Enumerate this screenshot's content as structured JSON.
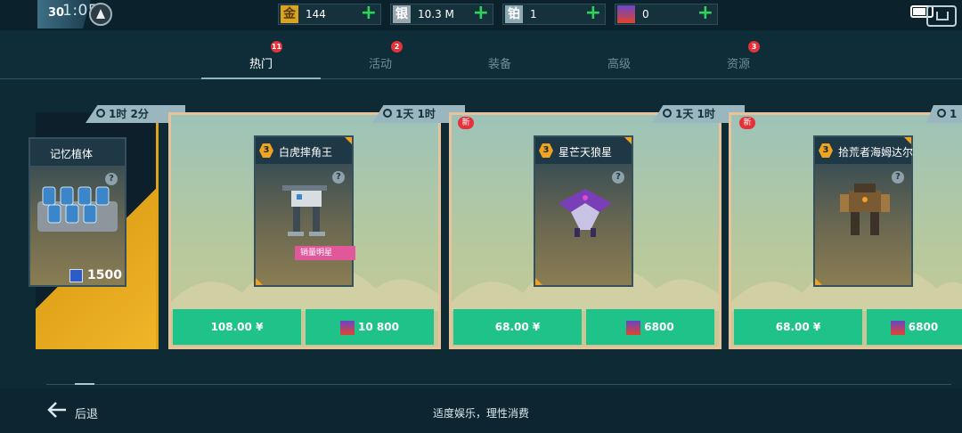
{
  "status": {
    "level": "30",
    "clock": "1:05"
  },
  "currencies": [
    {
      "icon": "金",
      "icon_name": "gold-icon",
      "value": "144"
    },
    {
      "icon": "银",
      "icon_name": "silver-icon",
      "value": "10.3 M"
    },
    {
      "icon": "铂",
      "icon_name": "platinum-icon",
      "value": "1"
    },
    {
      "icon": "",
      "icon_name": "fire-icon",
      "value": "0"
    }
  ],
  "tabs": [
    {
      "label": "热门",
      "badge": "11",
      "active": true
    },
    {
      "label": "活动",
      "badge": "2",
      "active": false
    },
    {
      "label": "装备",
      "badge": "",
      "active": false
    },
    {
      "label": "高级",
      "badge": "",
      "active": false
    },
    {
      "label": "资源",
      "badge": "3",
      "active": false
    }
  ],
  "offers": [
    {
      "name": "记忆植体",
      "timer": "1时 2分",
      "price_crystal": "1500",
      "new": false
    },
    {
      "name": "白虎摔角王",
      "timer": "1天 1时",
      "level": "3",
      "tag": "销量明星",
      "price_money": "108.00 ¥",
      "price_fire": "10 800",
      "new": false
    },
    {
      "name": "星芒天狼星",
      "timer": "1天 1时",
      "level": "3",
      "price_money": "68.00 ¥",
      "price_fire": "6800",
      "new": true,
      "new_label": "新"
    },
    {
      "name": "拾荒者海姆达尔",
      "timer": "1",
      "level": "3",
      "price_money": "68.00 ¥",
      "price_fire": "6800",
      "new": true,
      "new_label": "新"
    }
  ],
  "footer": {
    "back": "后退",
    "slogan": "适度娱乐，理性消费"
  },
  "colors": {
    "accent": "#1fc38a",
    "badge": "#e5323a",
    "gold": "#e0a31a"
  }
}
